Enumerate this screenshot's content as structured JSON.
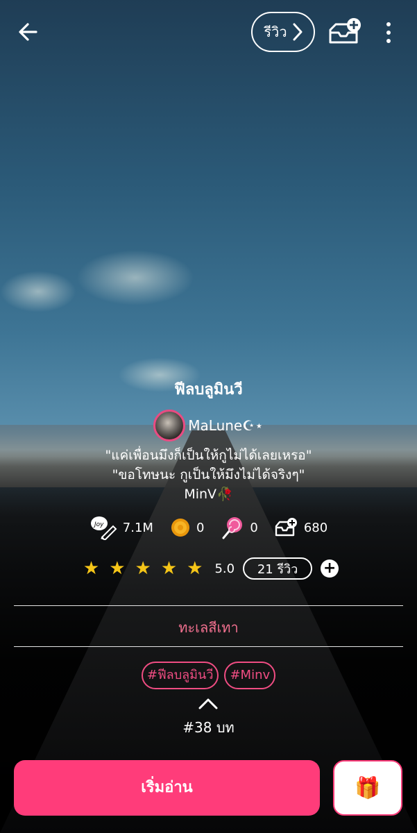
{
  "topbar": {
    "review_label": "รีวิว",
    "back_icon": "arrow-left-icon",
    "library_icon": "add-to-library-icon",
    "more_icon": "more-vertical-icon"
  },
  "novel": {
    "title": "ฟีลบลูมินวี",
    "author": "MaLune☪︎⋆",
    "description_lines": [
      "\"แค่เพื่อนมึงก็เป็นให้กูไม่ได้เลยเหรอ\"",
      "\"ขอโทษนะ กูเป็นให้มึงไม่ได้จริงๆ\"",
      "MinV🥀"
    ]
  },
  "stats": {
    "views": "7.1M",
    "coins": "0",
    "candies": "0",
    "library_adds": "680"
  },
  "rating": {
    "stars": 5,
    "value": "5.0",
    "review_count": "21 รีวิว"
  },
  "category": "ทะเลสีเทา",
  "tags": [
    "#ฟีลบลูมินวี",
    "#Minv"
  ],
  "episode": "#38 บท",
  "actions": {
    "read_label": "เริ่มอ่าน",
    "gift_icon": "gift-icon"
  },
  "colors": {
    "accent": "#ff3c7a",
    "tag": "#f04d83",
    "category": "#f1708f",
    "star": "#f5c518"
  }
}
